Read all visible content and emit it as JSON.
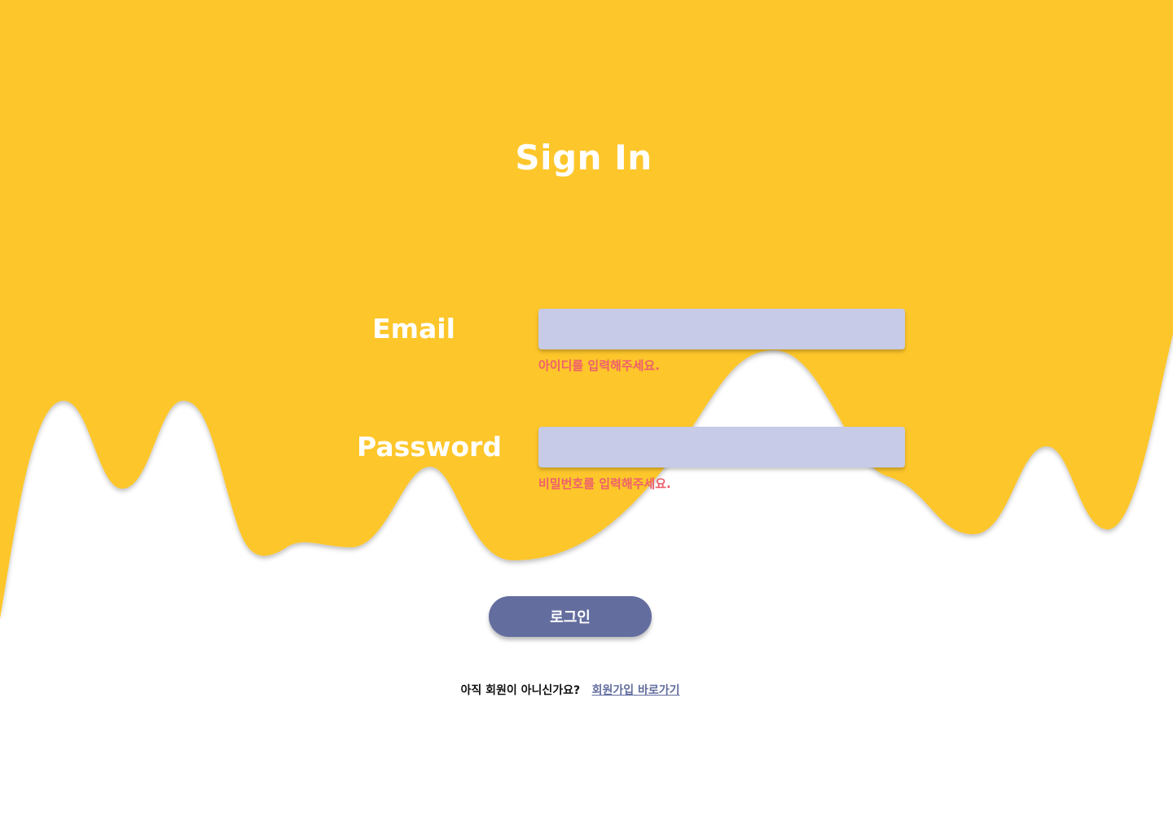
{
  "theme": {
    "background": "#ffffff",
    "drip_color": "#fdc62b",
    "input_fill": "#c7cbe7",
    "error_color": "#ee5f6c",
    "button_color": "#636d9e",
    "label_color": "#ffffff"
  },
  "page": {
    "title": "Sign In"
  },
  "form": {
    "email": {
      "label": "Email",
      "value": "",
      "error": "아이디를 입력해주세요."
    },
    "password": {
      "label": "Password",
      "value": "",
      "error": "비밀번호를 입력해주세요."
    },
    "login_button": "로그인"
  },
  "footer": {
    "prompt": "아직 회원이 아니신가요?",
    "signup_link": "회원가입 바로가기"
  }
}
